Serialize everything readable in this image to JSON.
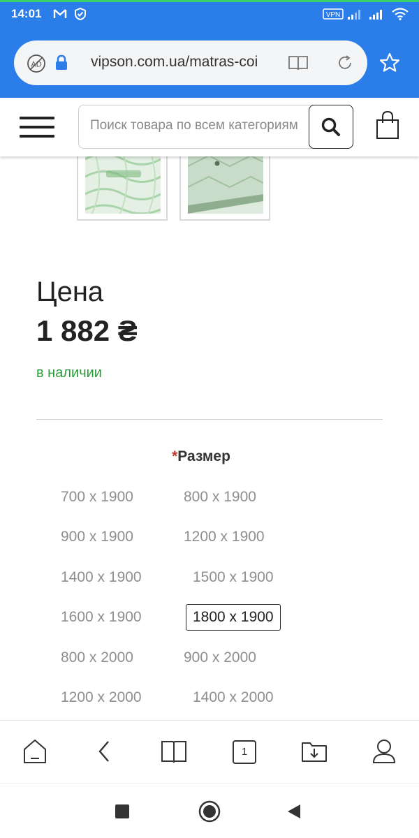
{
  "status_bar": {
    "time": "14:01",
    "vpn_label": "VPN",
    "icons": [
      "gmail-icon",
      "shield-icon",
      "vpn-icon",
      "signal-icon",
      "signal-icon",
      "wifi-icon"
    ]
  },
  "browser": {
    "url": "vipson.com.ua/matras-coi",
    "icons": [
      "adblock-icon",
      "lock-icon",
      "reader-icon",
      "reload-icon",
      "star-icon"
    ]
  },
  "site_header": {
    "search_placeholder": "Поиск товара по всем категориям",
    "icons": [
      "menu-icon",
      "search-icon",
      "shopping-bag-icon"
    ]
  },
  "product": {
    "price_label": "Цена",
    "price_value": "1 882 ₴",
    "stock_status": "в наличии",
    "size_title_required": "*",
    "size_title": "Размер",
    "sizes": [
      "700 x 1900",
      "800 x 1900",
      "900 x 1900",
      "1200 x 1900",
      "1400 x 1900",
      "1500 x 1900",
      "1600 x 1900",
      "1800 x 1900",
      "800 x 2000",
      "900 x 2000",
      "1200 x 2000",
      "1400 x 2000"
    ],
    "selected_size": "1800 x 1900"
  },
  "bottom_nav": {
    "tab_count": "1",
    "icons": [
      "home-icon",
      "back-icon",
      "bookmarks-icon",
      "tabs-icon",
      "downloads-icon",
      "profile-icon"
    ]
  },
  "system_nav": {
    "icons": [
      "recents-icon",
      "home-circle-icon",
      "back-triangle-icon"
    ]
  },
  "colors": {
    "accent_blue": "#2b7de9",
    "in_stock_green": "#2a9d3a",
    "required_red": "#c0392b"
  }
}
